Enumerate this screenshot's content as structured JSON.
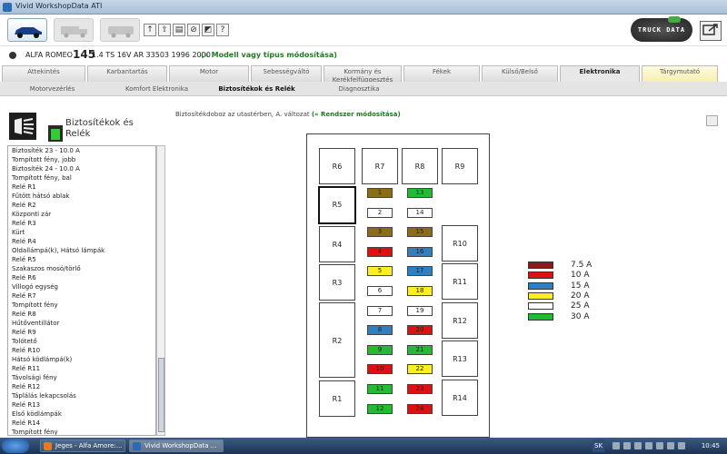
{
  "window": {
    "title": "Vivid WorkshopData ATI"
  },
  "toolbar": {
    "icons": [
      "↑",
      "⇧",
      "▤",
      "⊘",
      "◩",
      "?"
    ],
    "logo": "TRUCK DATA"
  },
  "vehicle": {
    "make": "ALFA ROMEO",
    "model": "145",
    "spec": "1.4 TS 16V AR 33503 1996 2000",
    "change_link": "(« Modell vagy típus módosítása)"
  },
  "main_tabs": [
    {
      "label": "Áttekintés"
    },
    {
      "label": "Karbantartás"
    },
    {
      "label": "Motor"
    },
    {
      "label": "Sebességváltó"
    },
    {
      "label": "Kormány és Kerékfelfüggesztés"
    },
    {
      "label": "Fékek"
    },
    {
      "label": "Külső/Belső"
    },
    {
      "label": "Elektronika"
    },
    {
      "label": "Tárgymutató"
    }
  ],
  "sub_tabs": [
    {
      "label": "Motorvezérlés"
    },
    {
      "label": "Komfort Elektronika"
    },
    {
      "label": "Biztosítékok és Relék"
    },
    {
      "label": "Diagnosztika"
    }
  ],
  "sidebar": {
    "title_line1": "Biztosítékok és",
    "title_line2": "Relék",
    "items": [
      "Biztosíték 23 - 10.0 A",
      "Tompított fény, jobb",
      "Biztosíték 24 - 10.0 A",
      "Tompított fény, bal",
      "Relé R1",
      "Fűtött hátsó ablak",
      "Relé R2",
      "Központi zár",
      "Relé R3",
      "Kürt",
      "Relé R4",
      "Oldallámpá(k), Hátsó lámpák",
      "Relé R5",
      "Szakaszos mosó/törlő",
      "Relé R6",
      "Villogó egység",
      "Relé R7",
      "Tompított fény",
      "Relé R8",
      "Hűtőventillátor",
      "Relé R9",
      "Tolótető",
      "Relé R10",
      "Hátsó ködlámpá(k)",
      "Relé R11",
      "Távolsági fény",
      "Relé R12",
      "Táplálás lekapcsolás",
      "Relé R13",
      "Első ködlámpák",
      "Relé R14",
      "Tompított fény"
    ]
  },
  "breadcrumb": {
    "text": "Biztosítékdoboz az utastérben, A. változat",
    "link": "(« Rendszer módosítása)"
  },
  "relays": {
    "r6": "R6",
    "r7": "R7",
    "r8": "R8",
    "r9": "R9",
    "r5": "R5",
    "r4": "R4",
    "r10": "R10",
    "r3": "R3",
    "r11": "R11",
    "r12": "R12",
    "r2": "R2",
    "r13": "R13",
    "r1": "R1",
    "r14": "R14"
  },
  "fuses": [
    {
      "n": "1",
      "color": "#8b6d14"
    },
    {
      "n": "13",
      "color": "#22bb33"
    },
    {
      "n": "2",
      "color": "#ffffff"
    },
    {
      "n": "14",
      "color": "#ffffff"
    },
    {
      "n": "3",
      "color": "#8b6d14"
    },
    {
      "n": "15",
      "color": "#8b6d14"
    },
    {
      "n": "4",
      "color": "#dd1111"
    },
    {
      "n": "16",
      "color": "#2f7fc1"
    },
    {
      "n": "5",
      "color": "#ffee22"
    },
    {
      "n": "17",
      "color": "#2f7fc1"
    },
    {
      "n": "6",
      "color": "#ffffff"
    },
    {
      "n": "18",
      "color": "#ffee22"
    },
    {
      "n": "7",
      "color": "#ffffff"
    },
    {
      "n": "19",
      "color": "#ffffff"
    },
    {
      "n": "8",
      "color": "#2f7fc1"
    },
    {
      "n": "20",
      "color": "#dd1111"
    },
    {
      "n": "9",
      "color": "#22bb33"
    },
    {
      "n": "21",
      "color": "#22bb33"
    },
    {
      "n": "10",
      "color": "#dd1111"
    },
    {
      "n": "22",
      "color": "#ffee22"
    },
    {
      "n": "11",
      "color": "#22bb33"
    },
    {
      "n": "23",
      "color": "#dd1111"
    },
    {
      "n": "12",
      "color": "#22bb33"
    },
    {
      "n": "24",
      "color": "#dd1111"
    }
  ],
  "legend": [
    {
      "label": "7.5 A",
      "color": "#8b1a1a"
    },
    {
      "label": "10 A",
      "color": "#dd1111"
    },
    {
      "label": "15 A",
      "color": "#2f7fc1"
    },
    {
      "label": "20 A",
      "color": "#ffee22"
    },
    {
      "label": "25 A",
      "color": "#ffffff"
    },
    {
      "label": "30 A",
      "color": "#22bb33"
    }
  ],
  "taskbar": {
    "tasks": [
      "Jeges - Alfa Amore:...",
      "Vivid WorkshopData ..."
    ],
    "lang": "SK",
    "time": "10:45"
  }
}
